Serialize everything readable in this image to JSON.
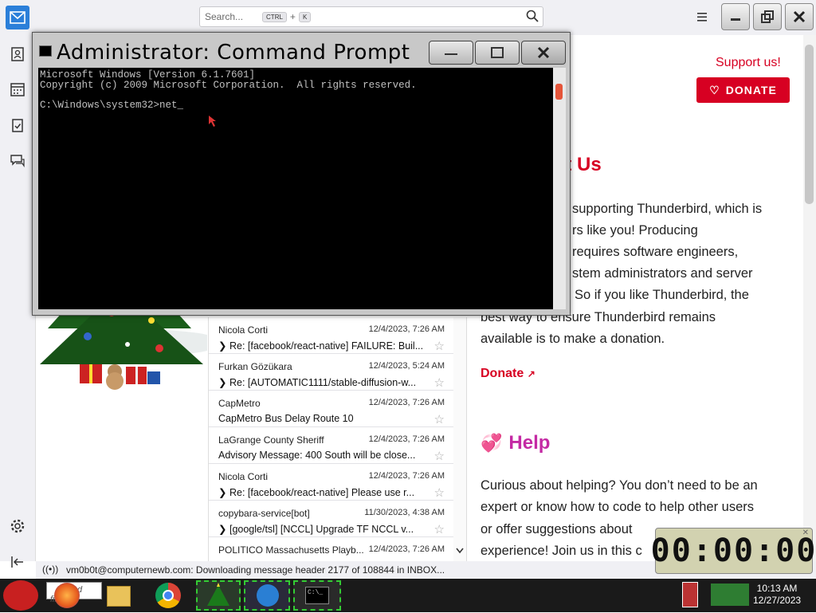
{
  "topbar": {
    "search_placeholder": "Search...",
    "shortcut_key1": "CTRL",
    "shortcut_plus": "+",
    "shortcut_key2": "K"
  },
  "sidebar": {
    "icons": [
      "address-book-icon",
      "calendar-icon",
      "tasks-icon",
      "chat-icon"
    ],
    "settings_icon": "gear-icon",
    "collapse_icon": "collapse-icon"
  },
  "messages": [
    {
      "sender": "Nicola Corti",
      "date": "12/4/2023, 7:26 AM",
      "subject": "Re: [facebook/react-native] FAILURE: Buil...",
      "thread": true
    },
    {
      "sender": "Furkan Gözükara",
      "date": "12/4/2023, 5:24 AM",
      "subject": "Re: [AUTOMATIC1111/stable-diffusion-w...",
      "thread": true
    },
    {
      "sender": "CapMetro",
      "date": "12/4/2023, 7:26 AM",
      "subject": "CapMetro Bus Delay Route 10",
      "thread": false
    },
    {
      "sender": "LaGrange County Sheriff",
      "date": "12/4/2023, 7:26 AM",
      "subject": "Advisory Message: 400 South will be close...",
      "thread": false
    },
    {
      "sender": "Nicola Corti",
      "date": "12/4/2023, 7:26 AM",
      "subject": "Re: [facebook/react-native] Please use r...",
      "thread": true
    },
    {
      "sender": "copybara-service[bot]",
      "date": "11/30/2023, 4:38 AM",
      "subject": "[google/tsl] [NCCL] Upgrade TF NCCL v...",
      "thread": true
    },
    {
      "sender": "POLITICO Massachusetts Playb...",
      "date": "12/4/2023, 7:26 AM",
      "subject": "",
      "thread": false
    }
  ],
  "page": {
    "support_link": "Support us!",
    "donate_button": "DONATE",
    "support_heading": "rt Us",
    "support_lines": [
      "supporting Thunderbird, which is",
      "rs like you! Producing",
      "requires software engineers,",
      "stem administrators and server",
      "So if you like Thunderbird, the",
      "best way to ensure Thunderbird remains",
      "available is to make a donation."
    ],
    "donate_link": "Donate",
    "help_heading": "Help",
    "help_lines": [
      "Curious about helping? You don’t need to be an",
      "expert or know how to code to help other users",
      "or offer suggestions about",
      "experience! Join us in this c"
    ]
  },
  "statusbar": {
    "text": "vm0b0t@computernewb.com: Downloading message header 2177 of 108844 in INBOX..."
  },
  "cmd": {
    "title": "Administrator: Command Prompt",
    "lines": [
      "Microsoft Windows [Version 6.1.7601]",
      "Copyright (c) 2009 Microsoft Corporation.  All rights reserved.",
      "",
      "C:\\Windows\\system32>net_"
    ]
  },
  "timer": {
    "value": "00:00:00"
  },
  "taskbar": {
    "time": "10:13 AM",
    "date": "12/27/2023",
    "search_hint": "d files"
  }
}
